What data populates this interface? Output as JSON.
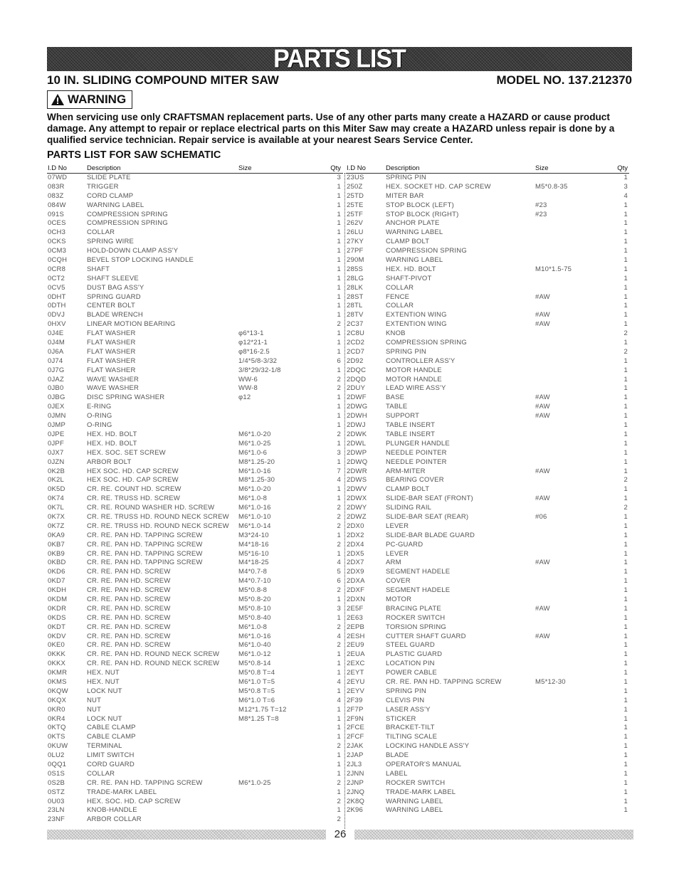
{
  "banner": {
    "title": "PARTS LIST"
  },
  "header": {
    "product": "10 IN. SLIDING COMPOUND MITER SAW",
    "model": "MODEL NO. 137.212370"
  },
  "warning": {
    "icon": "warning-triangle-icon",
    "label": "WARNING",
    "text": "When servicing use only CRAFTSMAN replacement parts. Use of any other parts many create a HAZARD or cause product damage. Any attempt to repair or replace electrical parts on this Miter Saw may create a HAZARD unless repair is done by a qualified service technician. Repair service is available at your nearest Sears Service Center."
  },
  "section_title": "PARTS LIST FOR SAW SCHEMATIC",
  "columns": {
    "id": "I.D No",
    "description": "Description",
    "size": "Size",
    "qty": "Qty"
  },
  "left_parts": [
    {
      "id": "07WD",
      "desc": "SLIDE PLATE",
      "size": "",
      "qty": "3"
    },
    {
      "id": "083R",
      "desc": "TRIGGER",
      "size": "",
      "qty": "1"
    },
    {
      "id": "083Z",
      "desc": "CORD CLAMP",
      "size": "",
      "qty": "1"
    },
    {
      "id": "084W",
      "desc": "WARNING LABEL",
      "size": "",
      "qty": "1"
    },
    {
      "id": "091S",
      "desc": "COMPRESSION SPRING",
      "size": "",
      "qty": "1"
    },
    {
      "id": "0CES",
      "desc": "COMPRESSION SPRING",
      "size": "",
      "qty": "1"
    },
    {
      "id": "0CH3",
      "desc": "COLLAR",
      "size": "",
      "qty": "1"
    },
    {
      "id": "0CKS",
      "desc": "SPRING WIRE",
      "size": "",
      "qty": "1"
    },
    {
      "id": "0CM3",
      "desc": "HOLD-DOWN CLAMP ASS'Y",
      "size": "",
      "qty": "1"
    },
    {
      "id": "0CQH",
      "desc": "BEVEL STOP LOCKING HANDLE",
      "size": "",
      "qty": "1"
    },
    {
      "id": "0CR8",
      "desc": "SHAFT",
      "size": "",
      "qty": "1"
    },
    {
      "id": "0CT2",
      "desc": "SHAFT SLEEVE",
      "size": "",
      "qty": "1"
    },
    {
      "id": "0CV5",
      "desc": "DUST BAG ASS'Y",
      "size": "",
      "qty": "1"
    },
    {
      "id": "0DHT",
      "desc": "SPRING GUARD",
      "size": "",
      "qty": "1"
    },
    {
      "id": "0DTH",
      "desc": "CENTER BOLT",
      "size": "",
      "qty": "1"
    },
    {
      "id": "0DVJ",
      "desc": "BLADE WRENCH",
      "size": "",
      "qty": "1"
    },
    {
      "id": "0HXV",
      "desc": "LINEAR MOTION BEARING",
      "size": "",
      "qty": "2"
    },
    {
      "id": "0J4E",
      "desc": "FLAT WASHER",
      "size": "φ6*13-1",
      "qty": "1"
    },
    {
      "id": "0J4M",
      "desc": "FLAT WASHER",
      "size": "φ12*21-1",
      "qty": "1"
    },
    {
      "id": "0J6A",
      "desc": "FLAT WASHER",
      "size": "φ8*16-2.5",
      "qty": "1"
    },
    {
      "id": "0J74",
      "desc": "FLAT WASHER",
      "size": "1/4*5/8-3/32",
      "qty": "6"
    },
    {
      "id": "0J7G",
      "desc": "FLAT WASHER",
      "size": "3/8*29/32-1/8",
      "qty": "1"
    },
    {
      "id": "0JAZ",
      "desc": "WAVE WASHER",
      "size": "WW-6",
      "qty": "2"
    },
    {
      "id": "0JB0",
      "desc": "WAVE WASHER",
      "size": "WW-8",
      "qty": "2"
    },
    {
      "id": "0JBG",
      "desc": "DISC SPRING WASHER",
      "size": "φ12",
      "qty": "1"
    },
    {
      "id": "0JEX",
      "desc": "E-RING",
      "size": "",
      "qty": "1"
    },
    {
      "id": "0JMN",
      "desc": "O-RING",
      "size": "",
      "qty": "1"
    },
    {
      "id": "0JMP",
      "desc": "O-RING",
      "size": "",
      "qty": "1"
    },
    {
      "id": "0JPE",
      "desc": "HEX. HD. BOLT",
      "size": "M6*1.0-20",
      "qty": "2"
    },
    {
      "id": "0JPF",
      "desc": "HEX. HD. BOLT",
      "size": "M6*1.0-25",
      "qty": "1"
    },
    {
      "id": "0JX7",
      "desc": "HEX. SOC. SET SCREW",
      "size": "M6*1.0-6",
      "qty": "3"
    },
    {
      "id": "0JZN",
      "desc": "ARBOR BOLT",
      "size": "M8*1.25-20",
      "qty": "1"
    },
    {
      "id": "0K2B",
      "desc": "HEX SOC. HD. CAP SCREW",
      "size": "M6*1.0-16",
      "qty": "7"
    },
    {
      "id": "0K2L",
      "desc": "HEX SOC. HD. CAP SCREW",
      "size": "M8*1.25-30",
      "qty": "4"
    },
    {
      "id": "0K5D",
      "desc": "CR. RE. COUNT HD. SCREW",
      "size": "M6*1.0-20",
      "qty": "1"
    },
    {
      "id": "0K74",
      "desc": "CR. RE. TRUSS HD. SCREW",
      "size": "M6*1.0-8",
      "qty": "1"
    },
    {
      "id": "0K7L",
      "desc": "CR. RE. ROUND WASHER HD. SCREW",
      "size": "M6*1.0-16",
      "qty": "2"
    },
    {
      "id": "0K7X",
      "desc": "CR. RE. TRUSS HD. ROUND NECK SCREW",
      "size": "M6*1.0-10",
      "qty": "2"
    },
    {
      "id": "0K7Z",
      "desc": "CR. RE. TRUSS HD. ROUND NECK SCREW",
      "size": "M6*1.0-14",
      "qty": "2"
    },
    {
      "id": "0KA9",
      "desc": "CR. RE. PAN HD. TAPPING SCREW",
      "size": "M3*24-10",
      "qty": "1"
    },
    {
      "id": "0KB7",
      "desc": "CR. RE. PAN HD. TAPPING SCREW",
      "size": "M4*18-16",
      "qty": "2"
    },
    {
      "id": "0KB9",
      "desc": "CR. RE. PAN HD. TAPPING SCREW",
      "size": "M5*16-10",
      "qty": "1"
    },
    {
      "id": "0KBD",
      "desc": "CR. RE. PAN HD. TAPPING SCREW",
      "size": "M4*18-25",
      "qty": "4"
    },
    {
      "id": "0KD6",
      "desc": "CR. RE. PAN HD. SCREW",
      "size": "M4*0.7-8",
      "qty": "5"
    },
    {
      "id": "0KD7",
      "desc": "CR. RE. PAN HD. SCREW",
      "size": "M4*0.7-10",
      "qty": "6"
    },
    {
      "id": "0KDH",
      "desc": "CR. RE. PAN HD. SCREW",
      "size": "M5*0.8-8",
      "qty": "2"
    },
    {
      "id": "0KDM",
      "desc": "CR. RE. PAN HD. SCREW",
      "size": "M5*0.8-20",
      "qty": "1"
    },
    {
      "id": "0KDR",
      "desc": "CR. RE. PAN HD. SCREW",
      "size": "M5*0.8-10",
      "qty": "3"
    },
    {
      "id": "0KDS",
      "desc": "CR. RE. PAN HD. SCREW",
      "size": "M5*0.8-40",
      "qty": "1"
    },
    {
      "id": "0KDT",
      "desc": "CR. RE. PAN HD. SCREW",
      "size": "M6*1.0-8",
      "qty": "2"
    },
    {
      "id": "0KDV",
      "desc": "CR. RE. PAN HD. SCREW",
      "size": "M6*1.0-16",
      "qty": "4"
    },
    {
      "id": "0KE0",
      "desc": "CR. RE. PAN HD. SCREW",
      "size": "M6*1.0-40",
      "qty": "2"
    },
    {
      "id": "0KKK",
      "desc": "CR. RE. PAN HD. ROUND NECK SCREW",
      "size": "M6*1.0-12",
      "qty": "1"
    },
    {
      "id": "0KKX",
      "desc": "CR. RE. PAN HD. ROUND NECK SCREW",
      "size": "M5*0.8-14",
      "qty": "1"
    },
    {
      "id": "0KMR",
      "desc": "HEX. NUT",
      "size": "M5*0.8 T=4",
      "qty": "1"
    },
    {
      "id": "0KMS",
      "desc": "HEX. NUT",
      "size": "M6*1.0 T=5",
      "qty": "4"
    },
    {
      "id": "0KQW",
      "desc": "LOCK NUT",
      "size": "M5*0.8 T=5",
      "qty": "1"
    },
    {
      "id": "0KQX",
      "desc": "NUT",
      "size": "M6*1.0 T=6",
      "qty": "4"
    },
    {
      "id": "0KR0",
      "desc": "NUT",
      "size": "M12*1.75 T=12",
      "qty": "1"
    },
    {
      "id": "0KR4",
      "desc": "LOCK NUT",
      "size": "M8*1.25 T=8",
      "qty": "1"
    },
    {
      "id": "0KTQ",
      "desc": "CABLE CLAMP",
      "size": "",
      "qty": "1"
    },
    {
      "id": "0KTS",
      "desc": "CABLE CLAMP",
      "size": "",
      "qty": "1"
    },
    {
      "id": "0KUW",
      "desc": "TERMINAL",
      "size": "",
      "qty": "2"
    },
    {
      "id": "0LU2",
      "desc": "LIMIT SWITCH",
      "size": "",
      "qty": "1"
    },
    {
      "id": "0QQ1",
      "desc": "CORD GUARD",
      "size": "",
      "qty": "1"
    },
    {
      "id": "0S1S",
      "desc": "COLLAR",
      "size": "",
      "qty": "1"
    },
    {
      "id": "0S2B",
      "desc": "CR. RE. PAN HD. TAPPING SCREW",
      "size": "M6*1.0-25",
      "qty": "2"
    },
    {
      "id": "0STZ",
      "desc": "TRADE-MARK LABEL",
      "size": "",
      "qty": "1"
    },
    {
      "id": "0U03",
      "desc": "HEX. SOC. HD. CAP SCREW",
      "size": "",
      "qty": "2"
    },
    {
      "id": "23LN",
      "desc": "KNOB-HANDLE",
      "size": "",
      "qty": "1"
    },
    {
      "id": "23NF",
      "desc": "ARBOR COLLAR",
      "size": "",
      "qty": "2"
    }
  ],
  "right_parts": [
    {
      "id": "23US",
      "desc": "SPRING PIN",
      "size": "",
      "qty": "1"
    },
    {
      "id": "250Z",
      "desc": "HEX. SOCKET HD. CAP SCREW",
      "size": "M5*0.8-35",
      "qty": "3"
    },
    {
      "id": "25TD",
      "desc": "MITER BAR",
      "size": "",
      "qty": "4"
    },
    {
      "id": "25TE",
      "desc": "STOP BLOCK (LEFT)",
      "size": "#23",
      "qty": "1"
    },
    {
      "id": "25TF",
      "desc": "STOP BLOCK (RIGHT)",
      "size": "#23",
      "qty": "1"
    },
    {
      "id": "262V",
      "desc": "ANCHOR PLATE",
      "size": "",
      "qty": "1"
    },
    {
      "id": "26LU",
      "desc": "WARNING LABEL",
      "size": "",
      "qty": "1"
    },
    {
      "id": "27KY",
      "desc": "CLAMP BOLT",
      "size": "",
      "qty": "1"
    },
    {
      "id": "27PF",
      "desc": "COMPRESSION SPRING",
      "size": "",
      "qty": "1"
    },
    {
      "id": "290M",
      "desc": "WARNING LABEL",
      "size": "",
      "qty": "1"
    },
    {
      "id": "285S",
      "desc": "HEX. HD. BOLT",
      "size": "M10*1.5-75",
      "qty": "1"
    },
    {
      "id": "28LG",
      "desc": "SHAFT-PIVOT",
      "size": "",
      "qty": "1"
    },
    {
      "id": "28LK",
      "desc": "COLLAR",
      "size": "",
      "qty": "1"
    },
    {
      "id": "28ST",
      "desc": "FENCE",
      "size": "#AW",
      "qty": "1"
    },
    {
      "id": "28TL",
      "desc": "COLLAR",
      "size": "",
      "qty": "1"
    },
    {
      "id": "28TV",
      "desc": "EXTENTION WING",
      "size": "#AW",
      "qty": "1"
    },
    {
      "id": "2C37",
      "desc": "EXTENTION WING",
      "size": "#AW",
      "qty": "1"
    },
    {
      "id": "2C8U",
      "desc": "KNOB",
      "size": "",
      "qty": "2"
    },
    {
      "id": "2CD2",
      "desc": "COMPRESSION SPRING",
      "size": "",
      "qty": "1"
    },
    {
      "id": "2CD7",
      "desc": "SPRING PIN",
      "size": "",
      "qty": "2"
    },
    {
      "id": "2D92",
      "desc": "CONTROLLER ASS'Y",
      "size": "",
      "qty": "1"
    },
    {
      "id": "2DQC",
      "desc": "MOTOR HANDLE",
      "size": "",
      "qty": "1"
    },
    {
      "id": "2DQD",
      "desc": "MOTOR HANDLE",
      "size": "",
      "qty": "1"
    },
    {
      "id": "2DUY",
      "desc": "LEAD WIRE ASS'Y",
      "size": "",
      "qty": "1"
    },
    {
      "id": "2DWF",
      "desc": "BASE",
      "size": "#AW",
      "qty": "1"
    },
    {
      "id": "2DWG",
      "desc": "TABLE",
      "size": "#AW",
      "qty": "1"
    },
    {
      "id": "2DWH",
      "desc": "SUPPORT",
      "size": "#AW",
      "qty": "1"
    },
    {
      "id": "2DWJ",
      "desc": "TABLE INSERT",
      "size": "",
      "qty": "1"
    },
    {
      "id": "2DWK",
      "desc": "TABLE INSERT",
      "size": "",
      "qty": "1"
    },
    {
      "id": "2DWL",
      "desc": "PLUNGER HANDLE",
      "size": "",
      "qty": "1"
    },
    {
      "id": "2DWP",
      "desc": "NEEDLE POINTER",
      "size": "",
      "qty": "1"
    },
    {
      "id": "2DWQ",
      "desc": "NEEDLE POINTER",
      "size": "",
      "qty": "1"
    },
    {
      "id": "2DWR",
      "desc": "ARM-MITER",
      "size": "#AW",
      "qty": "1"
    },
    {
      "id": "2DWS",
      "desc": "BEARING COVER",
      "size": "",
      "qty": "2"
    },
    {
      "id": "2DWV",
      "desc": "CLAMP BOLT",
      "size": "",
      "qty": "1"
    },
    {
      "id": "2DWX",
      "desc": "SLIDE-BAR SEAT (FRONT)",
      "size": "#AW",
      "qty": "1"
    },
    {
      "id": "2DWY",
      "desc": "SLIDING RAIL",
      "size": "",
      "qty": "2"
    },
    {
      "id": "2DWZ",
      "desc": "SLIDE-BAR SEAT (REAR)",
      "size": "#06",
      "qty": "1"
    },
    {
      "id": "2DX0",
      "desc": "LEVER",
      "size": "",
      "qty": "1"
    },
    {
      "id": "2DX2",
      "desc": "SLIDE-BAR BLADE GUARD",
      "size": "",
      "qty": "1"
    },
    {
      "id": "2DX4",
      "desc": "PC-GUARD",
      "size": "",
      "qty": "1"
    },
    {
      "id": "2DX5",
      "desc": "LEVER",
      "size": "",
      "qty": "1"
    },
    {
      "id": "2DX7",
      "desc": "ARM",
      "size": "#AW",
      "qty": "1"
    },
    {
      "id": "2DX9",
      "desc": "SEGMENT HADELE",
      "size": "",
      "qty": "1"
    },
    {
      "id": "2DXA",
      "desc": "COVER",
      "size": "",
      "qty": "1"
    },
    {
      "id": "2DXF",
      "desc": "SEGMENT HADELE",
      "size": "",
      "qty": "1"
    },
    {
      "id": "2DXN",
      "desc": "MOTOR",
      "size": "",
      "qty": "1"
    },
    {
      "id": "2E5F",
      "desc": "BRACING PLATE",
      "size": "#AW",
      "qty": "1"
    },
    {
      "id": "2E63",
      "desc": "ROCKER SWITCH",
      "size": "",
      "qty": "1"
    },
    {
      "id": "2EPB",
      "desc": "TORSION SPRING",
      "size": "",
      "qty": "1"
    },
    {
      "id": "2ESH",
      "desc": "CUTTER SHAFT GUARD",
      "size": "#AW",
      "qty": "1"
    },
    {
      "id": "2EU9",
      "desc": "STEEL GUARD",
      "size": "",
      "qty": "1"
    },
    {
      "id": "2EUA",
      "desc": "PLASTIC GUARD",
      "size": "",
      "qty": "1"
    },
    {
      "id": "2EXC",
      "desc": "LOCATION PIN",
      "size": "",
      "qty": "1"
    },
    {
      "id": "2EYT",
      "desc": "POWER CABLE",
      "size": "",
      "qty": "1"
    },
    {
      "id": "2EYU",
      "desc": "CR. RE. PAN HD. TAPPING SCREW",
      "size": "M5*12-30",
      "qty": "1"
    },
    {
      "id": "2EYV",
      "desc": "SPRING PIN",
      "size": "",
      "qty": "1"
    },
    {
      "id": "2F39",
      "desc": "CLEVIS PIN",
      "size": "",
      "qty": "1"
    },
    {
      "id": "2F7P",
      "desc": "LASER ASS'Y",
      "size": "",
      "qty": "1"
    },
    {
      "id": "2F9N",
      "desc": "STICKER",
      "size": "",
      "qty": "1"
    },
    {
      "id": "2FCE",
      "desc": "BRACKET-TILT",
      "size": "",
      "qty": "1"
    },
    {
      "id": "2FCF",
      "desc": "TILTING SCALE",
      "size": "",
      "qty": "1"
    },
    {
      "id": "2JAK",
      "desc": "LOCKING HANDLE ASS'Y",
      "size": "",
      "qty": "1"
    },
    {
      "id": "2JAP",
      "desc": "BLADE",
      "size": "",
      "qty": "1"
    },
    {
      "id": "2JL3",
      "desc": "OPERATOR'S MANUAL",
      "size": "",
      "qty": "1"
    },
    {
      "id": "2JNN",
      "desc": "LABEL",
      "size": "",
      "qty": "1"
    },
    {
      "id": "2JNP",
      "desc": "ROCKER SWITCH",
      "size": "",
      "qty": "1"
    },
    {
      "id": "2JNQ",
      "desc": "TRADE-MARK LABEL",
      "size": "",
      "qty": "1"
    },
    {
      "id": "2K8Q",
      "desc": "WARNING LABEL",
      "size": "",
      "qty": "1"
    },
    {
      "id": "2K96",
      "desc": "WARNING LABEL",
      "size": "",
      "qty": "1"
    }
  ],
  "footer": {
    "page_number": "26"
  }
}
